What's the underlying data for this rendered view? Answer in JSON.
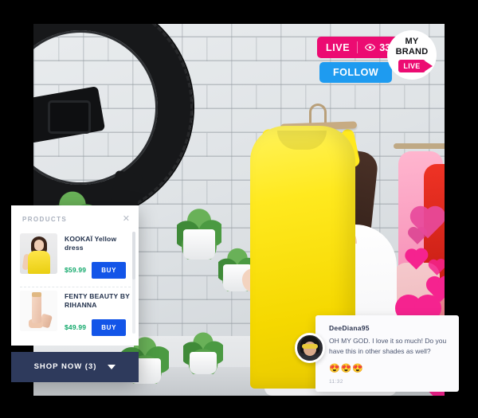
{
  "stream": {
    "live_badge": {
      "label": "LIVE",
      "viewers_icon": "eye-icon",
      "viewer_count": "33",
      "color": "#ec0b72"
    },
    "follow_button": {
      "label": "FOLLOW",
      "color": "#1e9bf0"
    },
    "brand_logo": {
      "line1": "MY",
      "line2": "BRAND",
      "badge": "LIVE",
      "badge_color": "#ec0b72",
      "icon": "video-camera-icon"
    }
  },
  "products_panel": {
    "title": "PRODUCTS",
    "close_icon": "close-icon",
    "items": [
      {
        "name": "KOOKAÏ Yellow dress",
        "price": "$59.99",
        "buy_label": "BUY",
        "thumb": "yellow-dress-thumbnail"
      },
      {
        "name": "FENTY BEAUTY BY RIHANNA",
        "price": "$49.99",
        "buy_label": "BUY",
        "thumb": "foundation-bottle-thumbnail"
      }
    ],
    "footer": {
      "label": "SHOP NOW (3)",
      "caret_icon": "chevron-down-icon",
      "color": "#2e3a5c"
    },
    "price_color": "#10a86a",
    "buy_color": "#1355e8"
  },
  "chat": {
    "username": "DeeDiana95",
    "message": "OH MY GOD. I love it so much! Do you have this in other shades as well?",
    "emojis": "😍😍😍",
    "timestamp": "11:32",
    "avatar": "user-avatar"
  },
  "reactions": {
    "icon": "heart-icon",
    "color": "#f5238f"
  }
}
